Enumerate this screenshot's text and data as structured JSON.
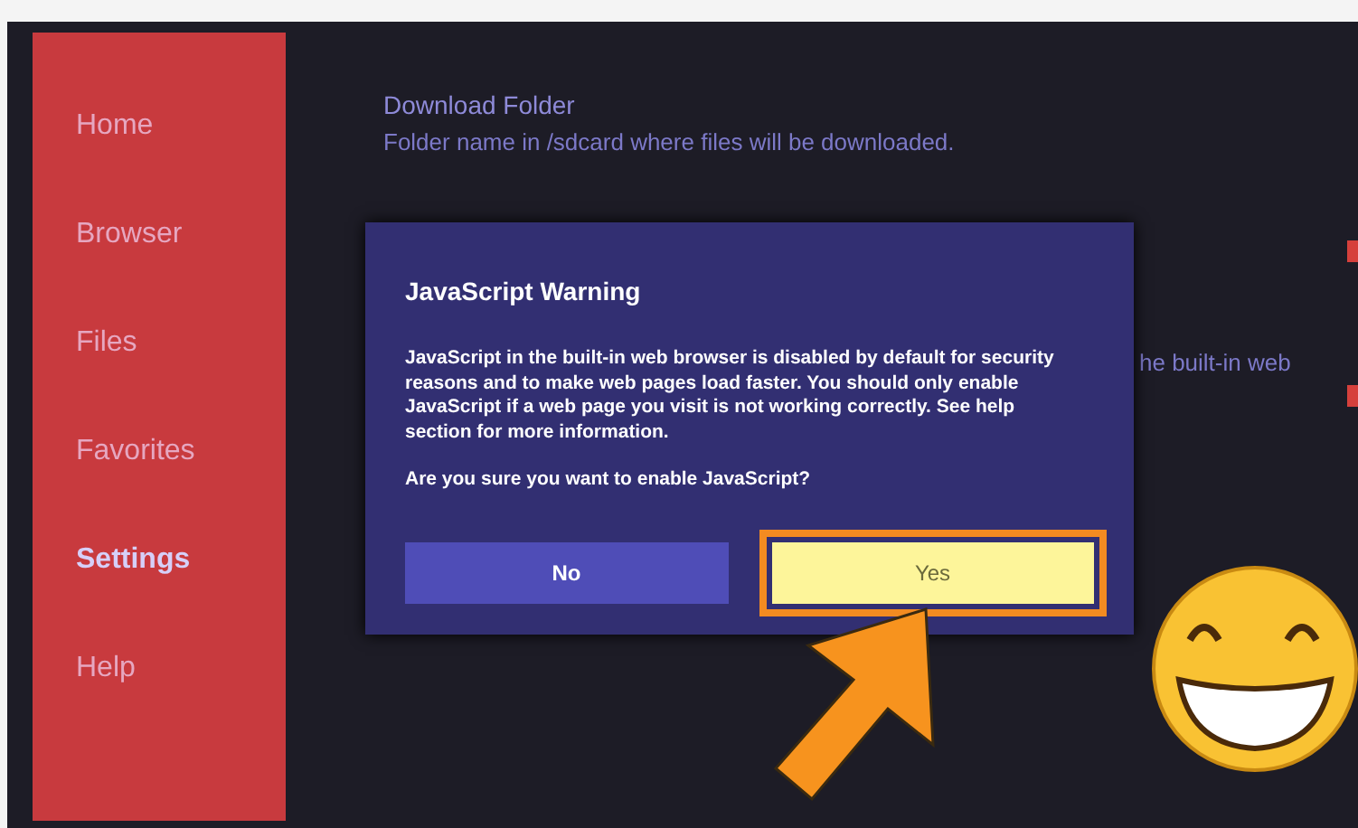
{
  "sidebar": {
    "items": [
      {
        "label": "Home",
        "selected": false
      },
      {
        "label": "Browser",
        "selected": false
      },
      {
        "label": "Files",
        "selected": false
      },
      {
        "label": "Favorites",
        "selected": false
      },
      {
        "label": "Settings",
        "selected": true
      },
      {
        "label": "Help",
        "selected": false
      }
    ]
  },
  "settings": [
    {
      "title": "Download Folder",
      "description": "Folder name in /sdcard where files will be downloaded."
    },
    {
      "description": "he built-in web"
    }
  ],
  "dialog": {
    "title": "JavaScript Warning",
    "message": "JavaScript in the built-in web browser is disabled by default for security reasons and to make web pages load faster. You should only enable JavaScript if a web page you visit is not working correctly. See help section for more information.",
    "question": "Are you sure you want to enable JavaScript?",
    "buttons": [
      {
        "label": "No",
        "focused": false
      },
      {
        "label": "Yes",
        "focused": true
      }
    ]
  }
}
